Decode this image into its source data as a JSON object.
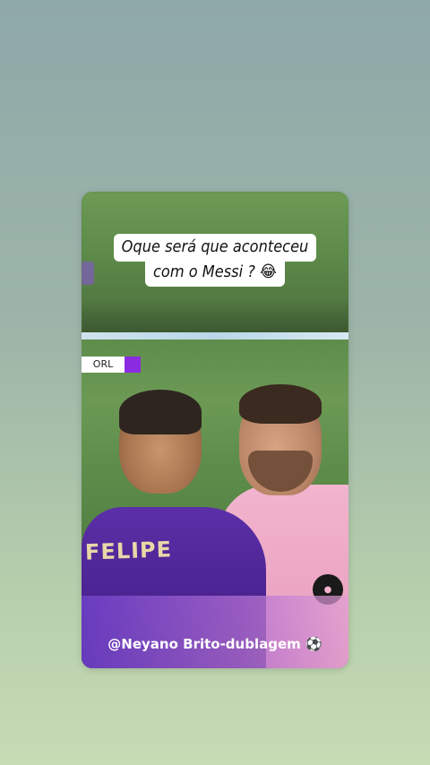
{
  "post": {
    "caption_line1": "Oque será que aconteceu",
    "caption_line2": "com o Messi ?",
    "caption_emoji": "😂",
    "scoreboard_team": "ORL",
    "jersey_name": "FELIPE",
    "watermark_text": "@Neyano Brito-dublagem",
    "watermark_emoji": "⚽"
  },
  "colors": {
    "background_top": "#8fa8a9",
    "background_bottom": "#c6dcb5",
    "orl_purple": "#8a2be2",
    "inter_pink": "#f2b4cf"
  }
}
